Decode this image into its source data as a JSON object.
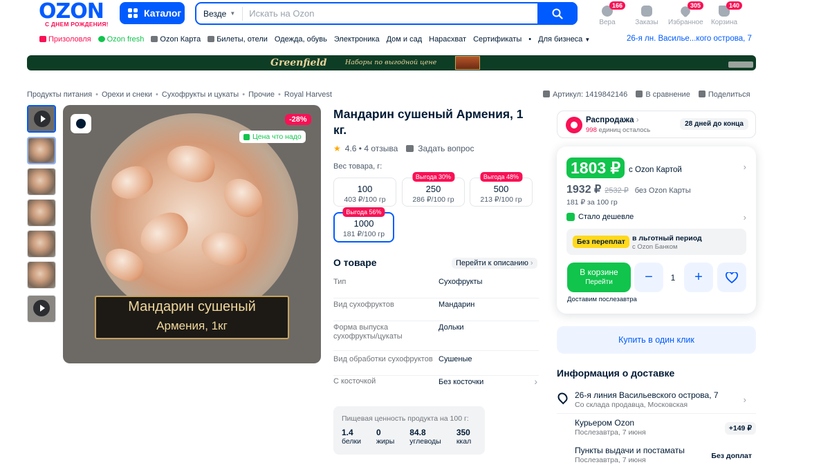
{
  "header": {
    "logo": "OZON",
    "logo_tagline": "С ДНЕМ РОЖДЕНИЯ!",
    "catalog_label": "Каталог",
    "search": {
      "scope": "Везде",
      "placeholder": "Искать на Ozon"
    },
    "nav": [
      {
        "label": "Вера",
        "badge": "166",
        "icon": "user-icon"
      },
      {
        "label": "Заказы",
        "badge": "",
        "icon": "box-icon"
      },
      {
        "label": "Избранное",
        "badge": "305",
        "icon": "heart-icon"
      },
      {
        "label": "Корзина",
        "badge": "140",
        "icon": "cart-icon"
      }
    ]
  },
  "subnav": {
    "items": [
      "Призоловля",
      "Ozon fresh",
      "Ozon Карта",
      "Билеты, отели",
      "Одежда, обувь",
      "Электроника",
      "Дом и сад",
      "Нарасхват",
      "Сертификаты",
      "•",
      "Для бизнеса"
    ],
    "address": "26-я лн. Василье...кого острова, 7"
  },
  "banner": {
    "brand": "Greenfield",
    "text": "Наборы по выгодной цене"
  },
  "breadcrumbs": [
    "Продукты питания",
    "Орехи и снеки",
    "Сухофрукты и цукаты",
    "Прочие",
    "Royal Harvest"
  ],
  "tools": {
    "article": "Артикул: 1419842146",
    "compare": "В сравнение",
    "share": "Поделиться"
  },
  "media": {
    "discount_badge": "-28%",
    "good_price": "Цена что надо",
    "caption_line1": "Мандарин сушеный",
    "caption_line2": "Армения, 1кг"
  },
  "product": {
    "title": "Мандарин сушеный Армения, 1 кг.",
    "rating": "4.6",
    "reviews": "4 отзыва",
    "ask": "Задать вопрос",
    "weight_label": "Вес товара, г:",
    "weights": [
      {
        "value": "100",
        "per": "403 ₽/100 гр",
        "save": ""
      },
      {
        "value": "250",
        "per": "286 ₽/100 гр",
        "save": "Выгода 30%"
      },
      {
        "value": "500",
        "per": "213 ₽/100 гр",
        "save": "Выгода 48%"
      },
      {
        "value": "1000",
        "per": "181 ₽/100 гр",
        "save": "Выгода 56%"
      }
    ],
    "about_title": "О товаре",
    "to_description": "Перейти к описанию",
    "specs": [
      {
        "k": "Тип",
        "v": "Сухофрукты"
      },
      {
        "k": "Вид сухофруктов",
        "v": "Мандарин"
      },
      {
        "k": "Форма выпуска сухофрукты/цукаты",
        "v": "Дольки"
      },
      {
        "k": "Вид обработки сухофруктов",
        "v": "Сушеные"
      },
      {
        "k": "С косточкой",
        "v": "Без косточки"
      }
    ],
    "nutrition": {
      "label": "Пищевая ценность продукта на 100 г:",
      "items": [
        {
          "n": "1.4",
          "u": "белки"
        },
        {
          "n": "0",
          "u": "жиры"
        },
        {
          "n": "84.8",
          "u": "углеводы"
        },
        {
          "n": "350",
          "u": "ккал"
        }
      ]
    }
  },
  "sale": {
    "title": "Распродажа",
    "remaining_count": "998",
    "remaining_text": "единиц осталось",
    "days": "28 дней до конца"
  },
  "price": {
    "card_price": "1803 ₽",
    "card_label": "с Ozon Картой",
    "price": "1932 ₽",
    "old_price": "2532 ₽",
    "no_card_label": "без Ozon Карты",
    "per_unit": "181 ₽ за 100 гр",
    "cheaper": "Стало дешевле",
    "grace_badge": "Без переплат",
    "grace_line1": "в льготный период",
    "grace_line2": "с Ozon Банком",
    "in_cart": "В корзине",
    "go": "Перейти",
    "qty": "1",
    "delivery": "Доставим послезавтра",
    "buy_one_click": "Купить в один клик"
  },
  "delivery": {
    "title": "Информация о доставке",
    "rows": [
      {
        "title": "26-я линия Васильевского острова, 7",
        "sub": "Со склада продавца, Московская",
        "price": ""
      },
      {
        "title": "Курьером Ozon",
        "sub": "Послезавтра, 7 июня",
        "price": "+149 ₽"
      },
      {
        "title": "Пункты выдачи и постаматы",
        "sub": "Послезавтра, 7 июня",
        "price": "Без доплат"
      }
    ]
  },
  "colors": {
    "brand": "#005bff",
    "accent": "#f91155",
    "green": "#10c44c"
  }
}
